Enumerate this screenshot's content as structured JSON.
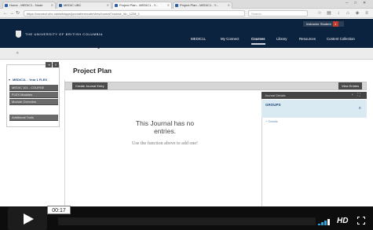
{
  "browser": {
    "tabs": [
      {
        "label": "Home - MEDIC1 - Node"
      },
      {
        "label": "MEDIC UBC"
      },
      {
        "label": "Project Plan - MEDIC1 - Y..."
      },
      {
        "label": "Project Plan - MEDIC1 - Y..."
      }
    ],
    "url": "https://connect.ubc.ca/webapps/journal/execute/viewJournal?course_id=_1234_1",
    "search_placeholder": "Search"
  },
  "site": {
    "university": "THE UNIVERSITY OF BRITISH COLUMBIA",
    "user_name": "Instructor Student",
    "notifications": "1",
    "nav": [
      {
        "label": "MEDIC1L",
        "active": false
      },
      {
        "label": "My Connect",
        "active": false
      },
      {
        "label": "Courses",
        "active": true
      },
      {
        "label": "Library",
        "active": false
      },
      {
        "label": "Resources",
        "active": false
      },
      {
        "label": "Content Collection",
        "active": false
      }
    ]
  },
  "course_menu": {
    "title": "MEDIC1L - Year 1 FLEX",
    "items": [
      {
        "label": "MEDIC 101 - COURSE"
      },
      {
        "label": "FLEX Modules"
      },
      {
        "label": "Module Overview"
      },
      {
        "label": "Additional Tools"
      }
    ]
  },
  "page": {
    "title": "Project Plan",
    "create_button": "Create Journal Entry",
    "view_button": "View Entries",
    "empty_title": "This Journal has no entries.",
    "empty_hint": "Use the function above to add one!"
  },
  "journal_panel": {
    "header": "Journal Details",
    "selected_name": "GROUPS",
    "selected_count": "0",
    "link": "+ Details"
  },
  "player": {
    "time": "00:17",
    "hd_label": "HD"
  }
}
